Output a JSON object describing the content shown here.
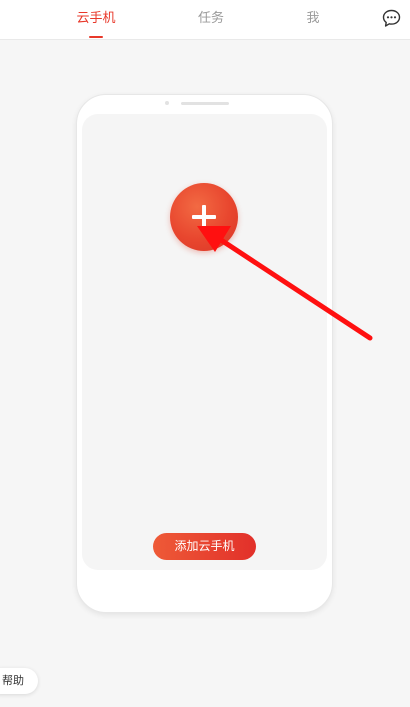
{
  "tabs": [
    {
      "label": "云手机",
      "active": true
    },
    {
      "label": "任务",
      "active": false
    },
    {
      "label": "我",
      "active": false
    }
  ],
  "header": {
    "message_icon": "chat-bubble-icon"
  },
  "main": {
    "add_icon": "plus-icon",
    "add_button_label": "添加云手机"
  },
  "help": {
    "label": "帮助"
  },
  "colors": {
    "accent": "#e8382a",
    "annotation_arrow": "#ff0000",
    "background": "#f6f6f6"
  }
}
